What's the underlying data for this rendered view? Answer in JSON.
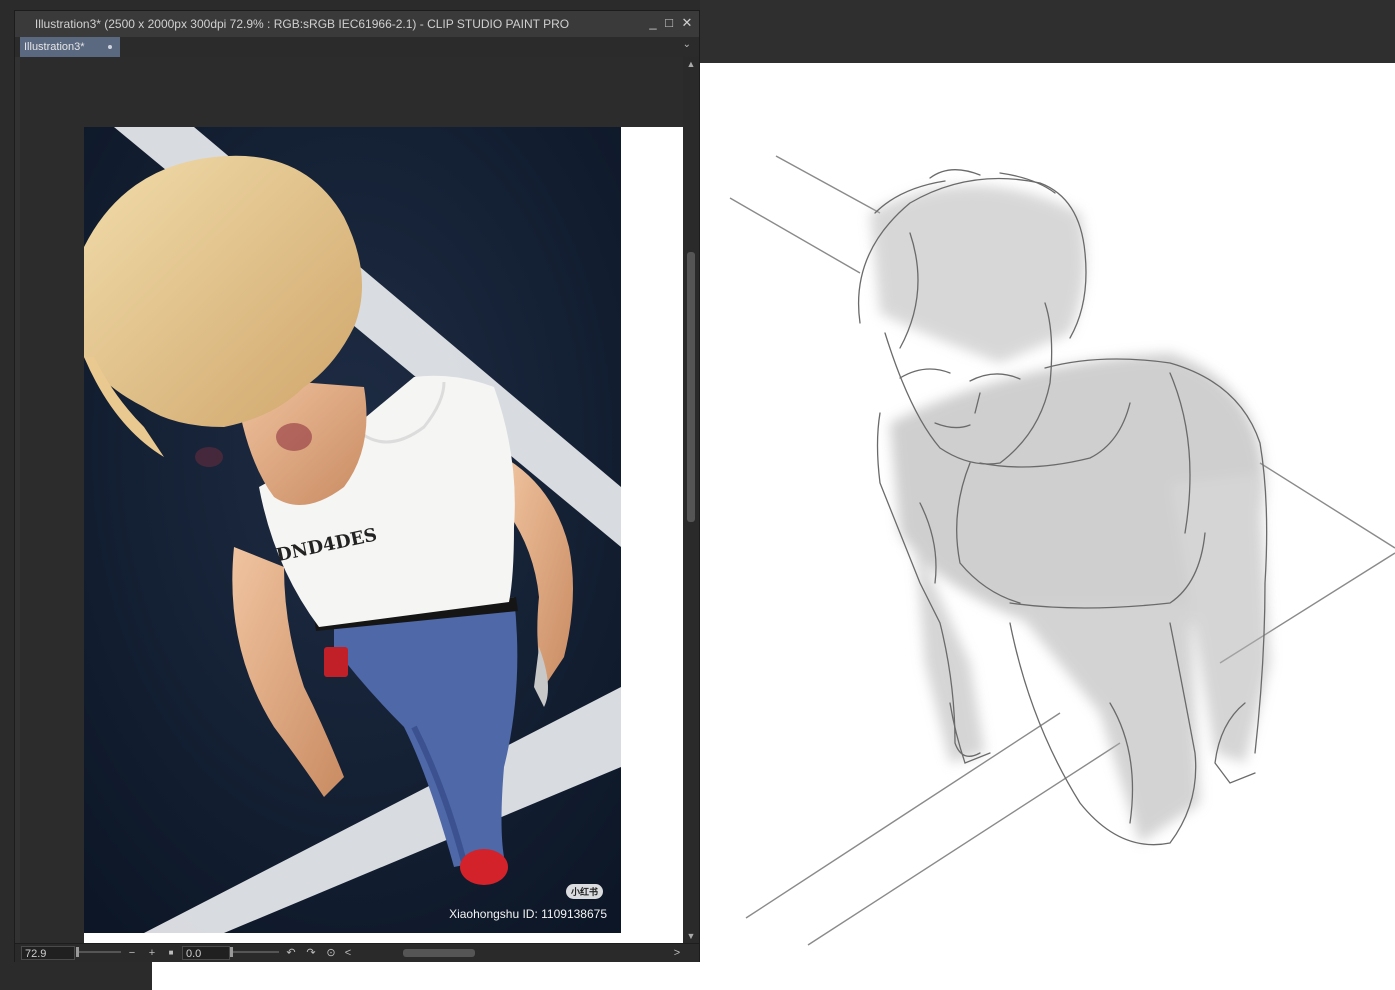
{
  "window": {
    "title": "Illustration3* (2500 x 2000px 300dpi 72.9% : RGB:sRGB IEC61966-2.1)  - CLIP STUDIO PAINT PRO",
    "minimize_glyph": "_",
    "maximize_glyph": "□",
    "close_glyph": "✕"
  },
  "tabs": [
    {
      "label": "Illustration3*"
    }
  ],
  "tab_menu_glyph": "⌄",
  "photo": {
    "watermark_logo": "小红书",
    "watermark_caption": "Xiaohongshu ID: 1109138675",
    "shirt_text": "DND4DES"
  },
  "status": {
    "zoom_value": "72.9",
    "zoom_out_glyph": "−",
    "zoom_in_glyph": "+",
    "fit_glyph": "■",
    "angle_value": "0.0",
    "rotate_left_glyph": "↶",
    "rotate_right_glyph": "↷",
    "reset_glyph": "⊙",
    "scroll_left_glyph": "<",
    "scroll_right_glyph": ">"
  },
  "colors": {
    "tab_active": "#5a6880",
    "hair": "#e3c48c",
    "road": "#142032",
    "jeans": "#4e68a8",
    "shoe": "#d3222a"
  }
}
